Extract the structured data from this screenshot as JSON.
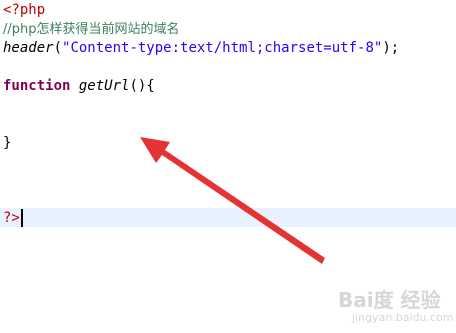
{
  "code": {
    "line1": {
      "text": "<?php"
    },
    "line2": {
      "text": "//php怎样获得当前网站的域名"
    },
    "line3": {
      "fn": "header",
      "open": "(",
      "string": "\"Content-type:text/html;charset=utf-8\"",
      "close": ");"
    },
    "line5": {
      "keyword": "function",
      "space": " ",
      "name": "getUrl",
      "rest": "(){"
    },
    "line8": {
      "text": "}"
    },
    "line11": {
      "text": "?>"
    }
  },
  "annotation": {
    "arrow_color": "#e53333"
  },
  "watermark": {
    "brand": "Bai度 经验",
    "url": "jingyan.baidu.com"
  }
}
